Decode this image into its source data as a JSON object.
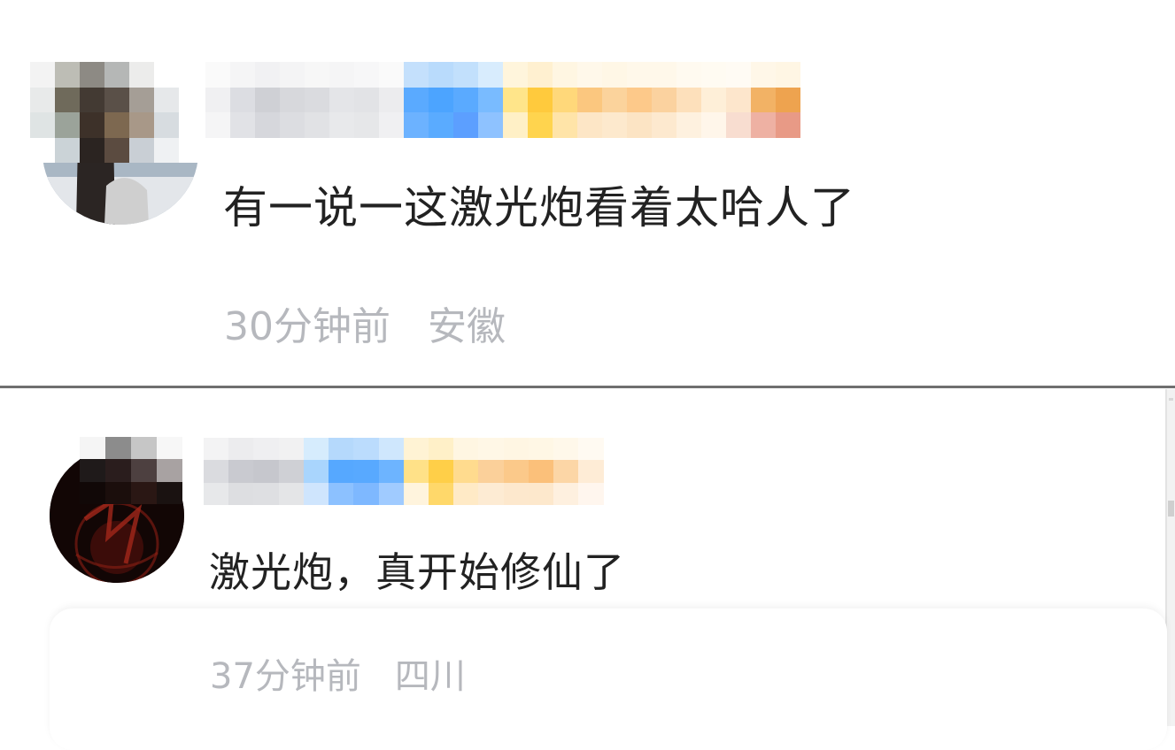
{
  "comments": [
    {
      "avatar_icon": "user-avatar-icon",
      "username_state": "pixelated",
      "text": "有一说一这激光炮看着太哈人了",
      "time": "30分钟前",
      "location": "安徽"
    },
    {
      "avatar_icon": "user-avatar-icon",
      "username_state": "pixelated",
      "text": "激光炮，真开始修仙了",
      "time": "37分钟前",
      "location": "四川"
    }
  ],
  "colors": {
    "text": "#222222",
    "meta": "#b6b8bd",
    "mosaic_blue": "#5aa8ff",
    "mosaic_gold": "#ffcc4d",
    "mosaic_orange": "#f0a04f",
    "mosaic_gray": "#d5d6db"
  }
}
